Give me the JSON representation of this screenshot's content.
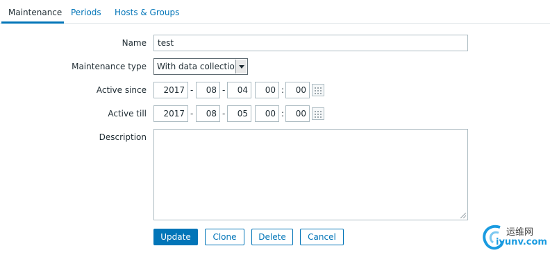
{
  "tabs": [
    {
      "label": "Maintenance",
      "active": true
    },
    {
      "label": "Periods",
      "active": false
    },
    {
      "label": "Hosts & Groups",
      "active": false
    }
  ],
  "form": {
    "name_label": "Name",
    "name_value": "test",
    "type_label": "Maintenance type",
    "type_value": "With data collection",
    "since_label": "Active since",
    "since": {
      "year": "2017",
      "month": "08",
      "day": "04",
      "hour": "00",
      "minute": "00"
    },
    "till_label": "Active till",
    "till": {
      "year": "2017",
      "month": "08",
      "day": "05",
      "hour": "00",
      "minute": "00"
    },
    "date_sep": "-",
    "time_sep": ":",
    "description_label": "Description",
    "description_value": ""
  },
  "buttons": {
    "update": "Update",
    "clone": "Clone",
    "delete": "Delete",
    "cancel": "Cancel"
  },
  "watermark": {
    "line1": "运维网",
    "line2": "iyunv.com"
  },
  "colors": {
    "accent": "#0275b8",
    "text": "#1f2c33",
    "border": "#acbbc2"
  },
  "icons": [
    "calendar-icon",
    "chevron-down-icon",
    "resize-grip-icon"
  ]
}
